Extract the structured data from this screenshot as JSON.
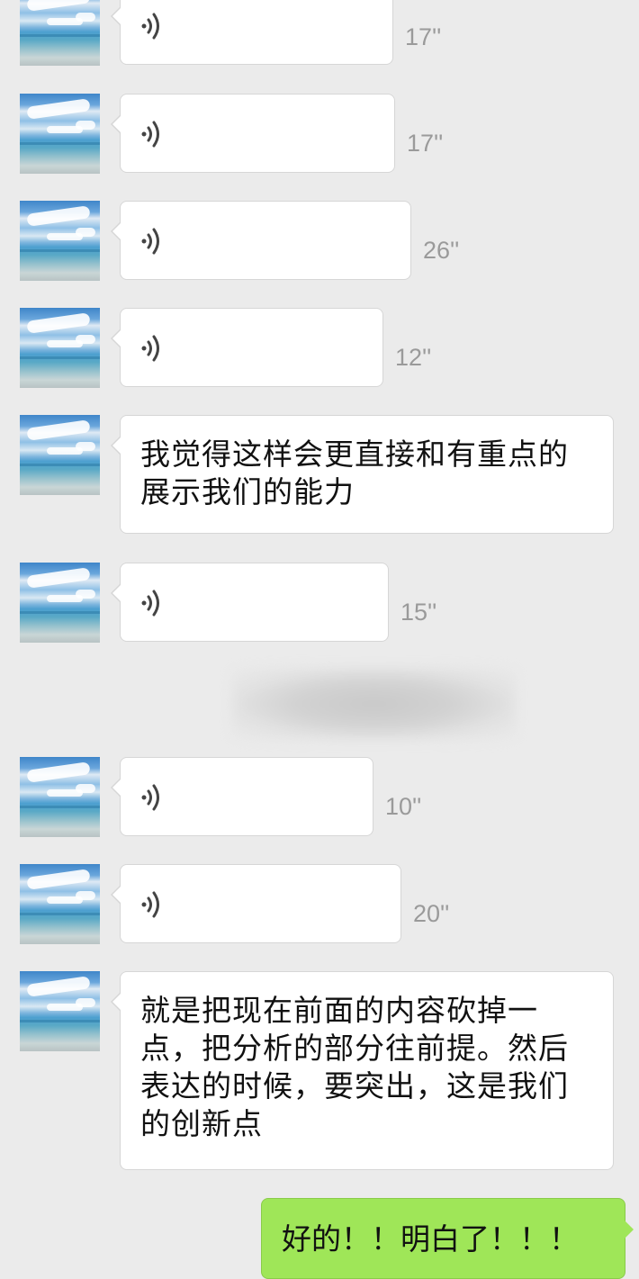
{
  "chat": {
    "messages": [
      {
        "type": "voice",
        "duration": "17''"
      },
      {
        "type": "voice",
        "duration": "17''"
      },
      {
        "type": "voice",
        "duration": "26''"
      },
      {
        "type": "voice",
        "duration": "12''"
      },
      {
        "type": "text",
        "line1": "我觉得这样会更直接和有重点的",
        "line2": "展示我们的能力"
      },
      {
        "type": "voice",
        "duration": "15''"
      },
      {
        "type": "voice",
        "duration": "10''"
      },
      {
        "type": "voice",
        "duration": "20''"
      },
      {
        "type": "text",
        "line1": "就是把现在前面的内容砍掉一",
        "line2": "点，把分析的部分往前提。然后",
        "line3": "表达的时候，要突出，这是我们",
        "line4": "的创新点"
      }
    ],
    "own_message": "好的！！明白了！！！"
  },
  "colors": {
    "background": "#ebebeb",
    "incoming_bubble": "#ffffff",
    "outgoing_bubble": "#9fe658",
    "duration_text": "#9a9a9a"
  },
  "icons": {
    "voice": "voice-wave-icon",
    "avatar": "sky-sea-avatar"
  }
}
